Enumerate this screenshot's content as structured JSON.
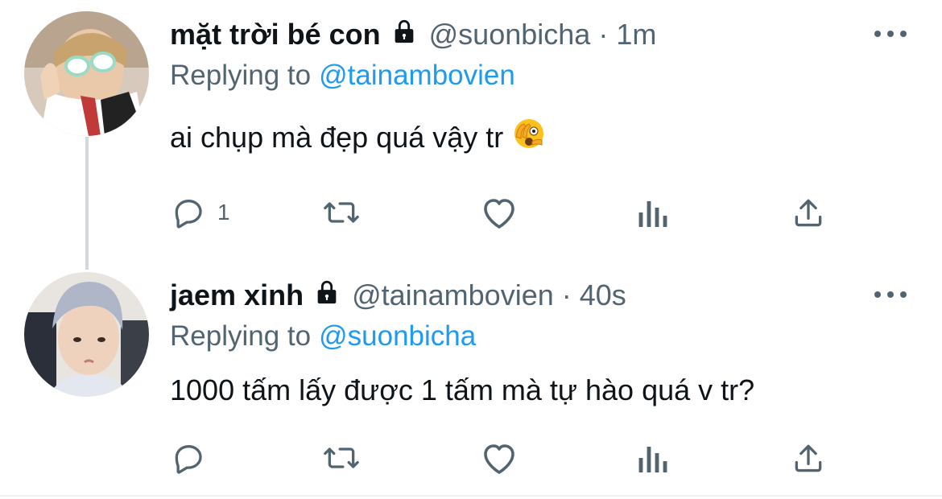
{
  "tweets": [
    {
      "display_name": "mặt trời bé con",
      "handle": "@suonbicha",
      "separator": "·",
      "time": "1m",
      "replying_prefix": "Replying to",
      "replying_to": "@tainambovien",
      "text": "ai chụp mà đẹp quá vậy tr",
      "emoji": "face-with-peeking-eye",
      "reply_count": "1",
      "protected": true,
      "avatar": "avatar-photo-1"
    },
    {
      "display_name": "jaem xinh",
      "handle": "@tainambovien",
      "separator": "·",
      "time": "40s",
      "replying_prefix": "Replying to",
      "replying_to": "@suonbicha",
      "text": "1000 tấm lấy được 1 tấm mà tự hào quá v tr?",
      "reply_count": "",
      "protected": true,
      "avatar": "avatar-photo-2"
    }
  ],
  "icons": [
    "reply-icon",
    "retweet-icon",
    "like-icon",
    "analytics-icon",
    "share-icon",
    "more-icon",
    "lock-icon"
  ],
  "colors": {
    "text": "#0f1419",
    "secondary": "#536471",
    "link": "#1d9bf0",
    "thread_line": "#cfd9de"
  }
}
